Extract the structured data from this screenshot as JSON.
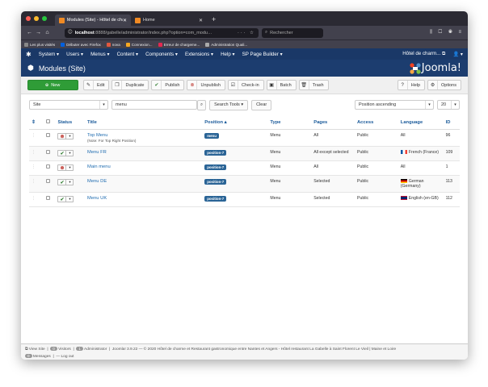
{
  "browser": {
    "tabs": [
      {
        "label": "Modules (Site) - Hôtel de charm"
      },
      {
        "label": "Home"
      }
    ],
    "url_host": "localhost",
    "url_rest": ":8888/gabelle/administrator/index.php?option=com_modu…",
    "search_placeholder": "Rechercher",
    "bookmarks": [
      {
        "label": "Les plus visités"
      },
      {
        "label": "Débuter avec Firefox"
      },
      {
        "label": "nova"
      },
      {
        "label": "Connexion..."
      },
      {
        "label": "Erreur de chargeme..."
      },
      {
        "label": "Administration Quali..."
      }
    ]
  },
  "admin_menu": {
    "items": [
      {
        "label": "System ▾"
      },
      {
        "label": "Users ▾"
      },
      {
        "label": "Menus ▾"
      },
      {
        "label": "Content ▾"
      },
      {
        "label": "Components ▾"
      },
      {
        "label": "Extensions ▾"
      },
      {
        "label": "Help ▾"
      },
      {
        "label": "SP Page Builder ▾"
      }
    ],
    "site_link": "Hôtel de charm... ⧉",
    "user": "👤 ▾"
  },
  "header": {
    "title": "Modules (Site)",
    "logo_text": "Joomla!"
  },
  "toolbar": {
    "new": "New",
    "edit": "Edit",
    "duplicate": "Duplicate",
    "publish": "Publish",
    "unpublish": "Unpublish",
    "checkin": "Check-in",
    "batch": "Batch",
    "trash": "Trash",
    "help": "Help",
    "options": "Options"
  },
  "filters": {
    "client": "Site",
    "search_value": "menu",
    "search_tools": "Search Tools ▾",
    "clear": "Clear",
    "ordering": "Position ascending",
    "limit": "20"
  },
  "table": {
    "headers": {
      "sort": "⇕",
      "status": "Status",
      "title": "Title",
      "position": "Position ▴",
      "type": "Type",
      "pages": "Pages",
      "access": "Access",
      "language": "Language",
      "id": "ID"
    },
    "rows": [
      {
        "status": "unpublished",
        "title": "Top Menu",
        "note": "(Note: For Top Right Position)",
        "position": "menu",
        "type": "Menu",
        "pages": "All",
        "access": "Public",
        "language": "All",
        "flag": "",
        "id": "96"
      },
      {
        "status": "published",
        "title": "Menu FR",
        "note": "",
        "position": "position-7",
        "type": "Menu",
        "pages": "All except selected",
        "access": "Public",
        "language": "French (France)",
        "flag": "fr",
        "id": "109"
      },
      {
        "status": "unpublished",
        "title": "Main menu",
        "note": "",
        "position": "position-7",
        "type": "Menu",
        "pages": "All",
        "access": "Public",
        "language": "All",
        "flag": "",
        "id": "1"
      },
      {
        "status": "published",
        "title": "Menu DE",
        "note": "",
        "position": "position-7",
        "type": "Menu",
        "pages": "Selected",
        "access": "Public",
        "language": "German (Germany)",
        "flag": "de",
        "id": "113"
      },
      {
        "status": "published",
        "title": "Menu UK",
        "note": "",
        "position": "position-7",
        "type": "Menu",
        "pages": "Selected",
        "access": "Public",
        "language": "English (en-GB)",
        "flag": "uk",
        "id": "112"
      }
    ]
  },
  "footer": {
    "view_site": "View Site",
    "visitors_count": "0",
    "visitors": "Visitors",
    "admin_count": "1",
    "administrator": "Administrator",
    "copyright": "Joomla! 3.9.22 — © 2020 Hôtel de charme et Restaurant gastronomique entre Nantes et Angers - Hôtel restaurant La Gabelle à Saint Florent Le Vieil | Maine et Loire",
    "messages_count": "0",
    "messages": "Messages",
    "logout": "Log out"
  },
  "colors": {
    "admin_bar": "#1a3867",
    "header": "#1c3d6f",
    "new_button": "#2f9c37",
    "link": "#1f6cb0",
    "badge": "#2a6496"
  }
}
